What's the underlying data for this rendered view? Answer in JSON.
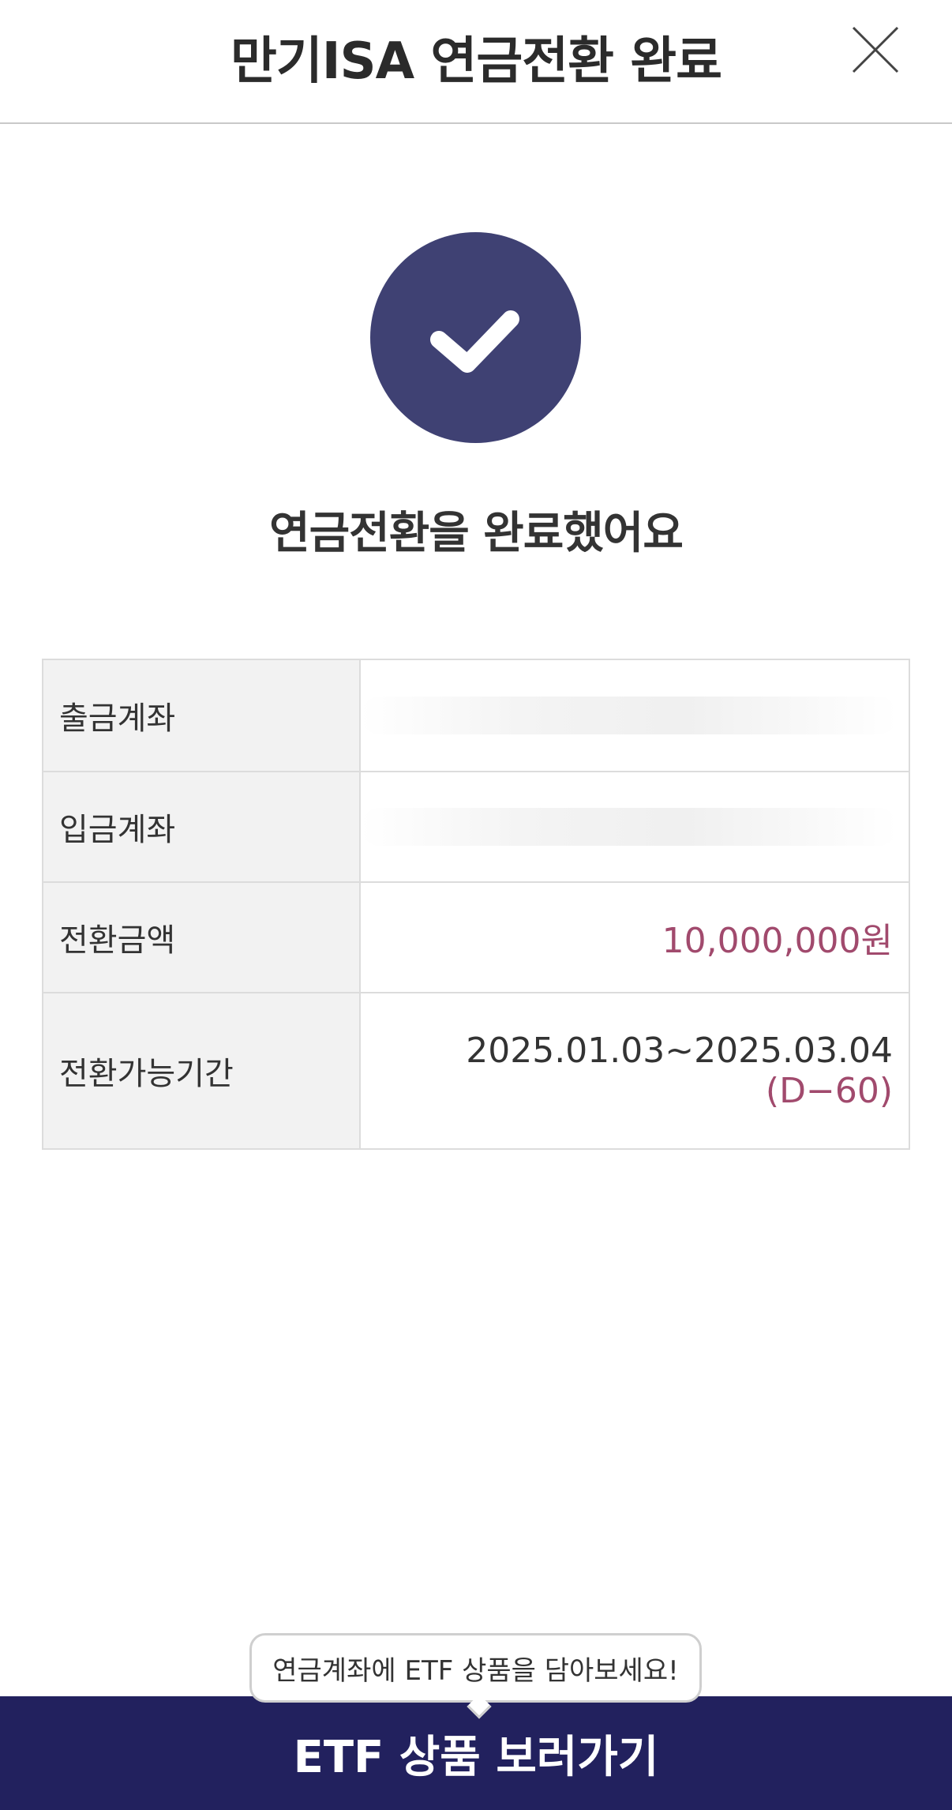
{
  "header": {
    "title": "만기ISA 연금전환 완료",
    "close_icon": "close-icon"
  },
  "status": {
    "icon": "check-icon",
    "icon_bg_color": "#3f4173",
    "message": "연금전환을 완료했어요"
  },
  "details": {
    "rows": [
      {
        "label": "출금계좌",
        "value": ""
      },
      {
        "label": "입금계좌",
        "value": ""
      },
      {
        "label": "전환금액",
        "value": "10,000,000원"
      },
      {
        "label": "전환가능기간",
        "value": "2025.01.03~2025.03.04",
        "sub_value": "(D−60)"
      }
    ],
    "accent_color": "#a14a6d"
  },
  "footer": {
    "tooltip": "연금계좌에 ETF 상품을 담아보세요!",
    "button_label": "ETF 상품 보러가기",
    "button_color": "#22215e"
  }
}
